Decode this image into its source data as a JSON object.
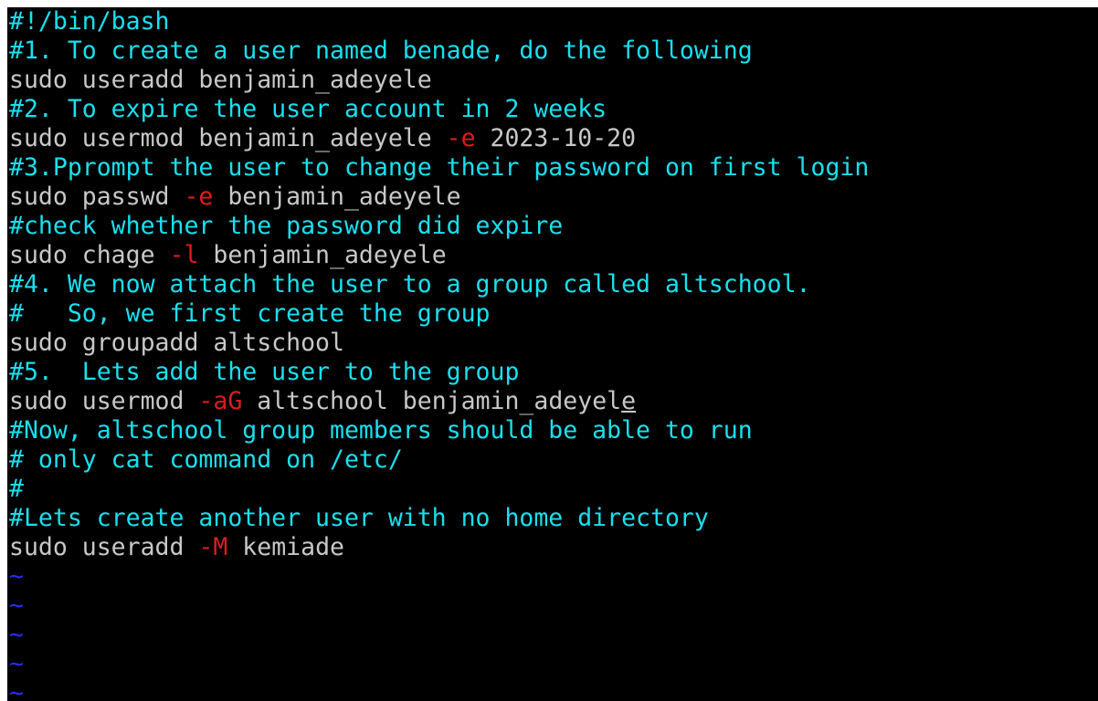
{
  "editor": {
    "colors": {
      "background": "#000000",
      "comment": "#19e0ee",
      "code": "#c8c8c8",
      "flag": "#e01b1b",
      "tilde": "#2a2aff"
    },
    "lines": [
      {
        "comment": "#!/bin/bash"
      },
      {
        "comment": "#1. To create a user named benade, do the following"
      },
      {
        "code": "sudo useradd benjamin_adeyele"
      },
      {
        "comment": "#2. To expire the user account in 2 weeks"
      },
      {
        "pre": "sudo usermod benjamin_adeyele ",
        "flag": "-e",
        "post": " 2023-10-20"
      },
      {
        "comment": "#3.Pprompt the user to change their password on first login"
      },
      {
        "pre": "sudo passwd ",
        "flag": "-e",
        "post": " benjamin_adeyele"
      },
      {
        "comment": "#check whether the password did expire"
      },
      {
        "pre": "sudo chage ",
        "flag": "-l",
        "post": " benjamin_adeyele"
      },
      {
        "comment": "#4. We now attach the user to a group called altschool."
      },
      {
        "comment": "#   So, we first create the group"
      },
      {
        "code": "sudo groupadd altschool"
      },
      {
        "comment": "#5.  Lets add the user to the group"
      },
      {
        "pre": "sudo usermod ",
        "flag": "-aG",
        "post": " altschool benjamin_adeyel",
        "cursor_char": "e"
      },
      {
        "comment": "#Now, altschool group members should be able to run"
      },
      {
        "comment": "# only cat command on /etc/"
      },
      {
        "comment": "#"
      },
      {
        "comment": "#Lets create another user with no home directory"
      },
      {
        "pre": "sudo useradd ",
        "flag": "-M",
        "post": " kemiade"
      },
      {
        "tilde": "~"
      },
      {
        "tilde": "~"
      },
      {
        "tilde": "~"
      },
      {
        "tilde": "~"
      },
      {
        "tilde": "~"
      }
    ]
  }
}
